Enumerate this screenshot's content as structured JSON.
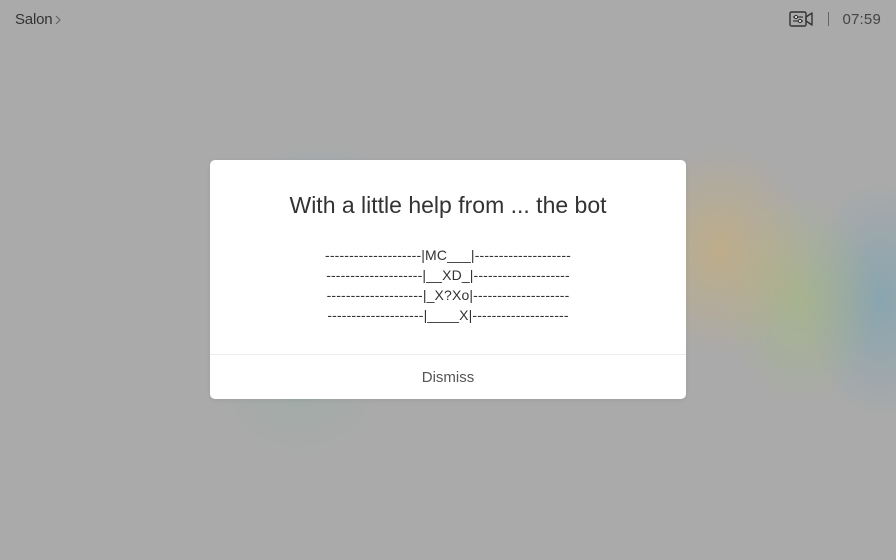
{
  "header": {
    "room_name": "Salon",
    "clock": "07:59",
    "icons": {
      "room_chevron": "chevron-right-icon",
      "camera": "video-camera-settings-icon"
    }
  },
  "dialog": {
    "title": "With a little help from ... the bot",
    "lines": [
      "--------------------|MC___|--------------------",
      "--------------------|__XD_|--------------------",
      "--------------------|_X?Xo|--------------------",
      "--------------------|____X|--------------------"
    ],
    "dismiss_label": "Dismiss"
  }
}
